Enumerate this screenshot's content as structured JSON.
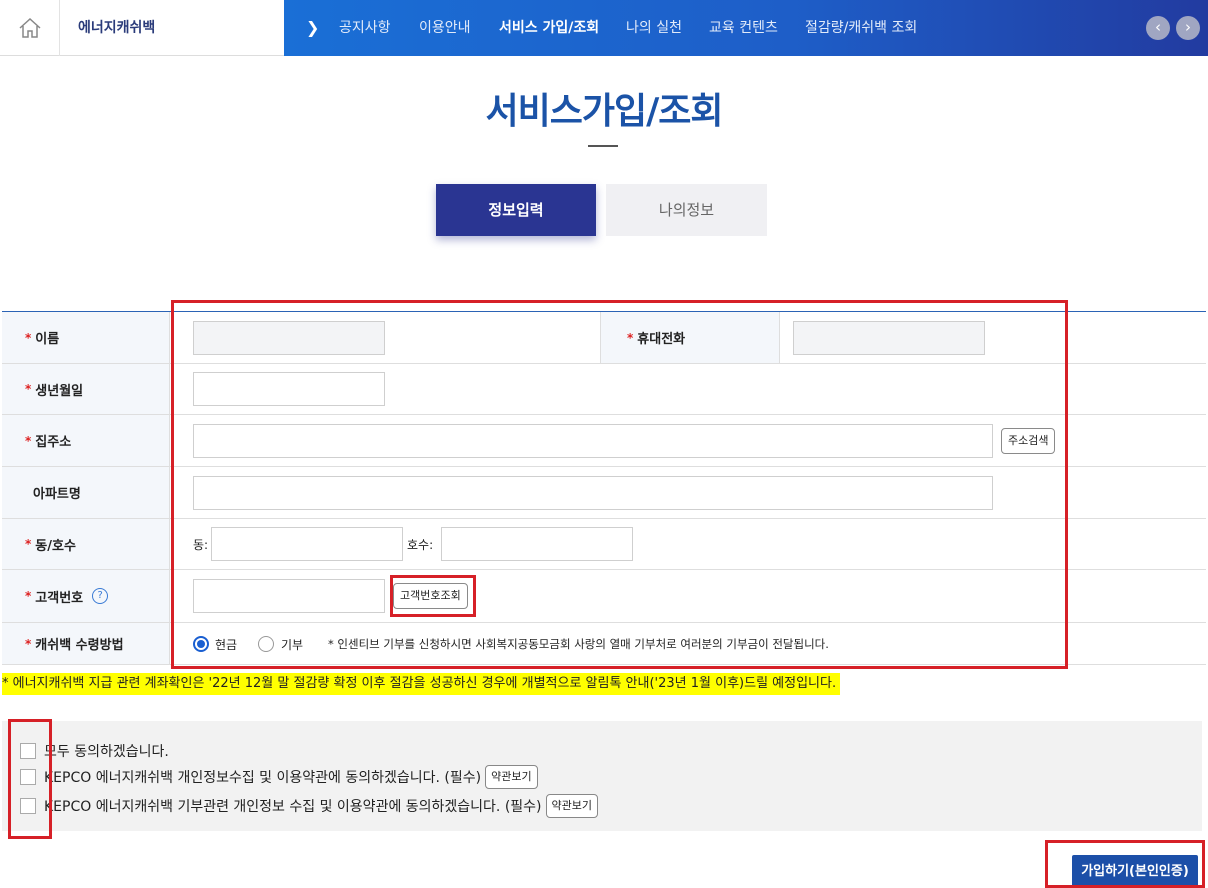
{
  "header": {
    "site_name": "에너지캐쉬백",
    "nav": [
      "공지사항",
      "이용안내",
      "서비스 가입/조회",
      "나의 실천",
      "교육 컨텐츠",
      "절감량/캐쉬백 조회"
    ],
    "active_nav": "서비스 가입/조회",
    "prev_symbol": "‹",
    "next_symbol": "›"
  },
  "page": {
    "title": "서비스가입/조회",
    "tabs": [
      "정보입력",
      "나의정보"
    ]
  },
  "form": {
    "required_mark": "*",
    "name_label": "이름",
    "phone_label": "휴대전화",
    "birth_label": "생년월일",
    "address_label": "집주소",
    "address_search_button": "주소검색",
    "apartment_label": "아파트명",
    "unit_label": "동/호수",
    "dong_prefix": "동:",
    "hosu_prefix": "호수:",
    "customer_no_label": "고객번호",
    "help_symbol": "?",
    "customer_lookup_button": "고객번호조회",
    "cashback_label": "캐쉬백 수령방법",
    "option_cash": "현금",
    "option_donation": "기부",
    "donation_note": "* 인센티브 기부를 신청하시면 사회복지공동모금회 사랑의 열매 기부처로 여러분의 기부금이 전달됩니다."
  },
  "notice": "* 에너지캐쉬백 지급 관련 계좌확인은 '22년 12월 말 절감량 확정 이후 절감을 성공하신 경우에 개별적으로 알림톡 안내('23년 1월 이후)드릴 예정입니다.",
  "agreements": {
    "all": "모두 동의하겠습니다.",
    "privacy": "KEPCO 에너지캐쉬백 개인정보수집 및 이용약관에 동의하겠습니다. (필수)",
    "donation": "KEPCO 에너지캐쉬백 기부관련 개인정보 수집 및 이용약관에 동의하겠습니다. (필수)",
    "terms_button": "약관보기"
  },
  "join_button": "가입하기(본인인증)",
  "colors": {
    "accent": "#2a3592",
    "annotation": "#d62027",
    "highlight": "#ffff00"
  }
}
